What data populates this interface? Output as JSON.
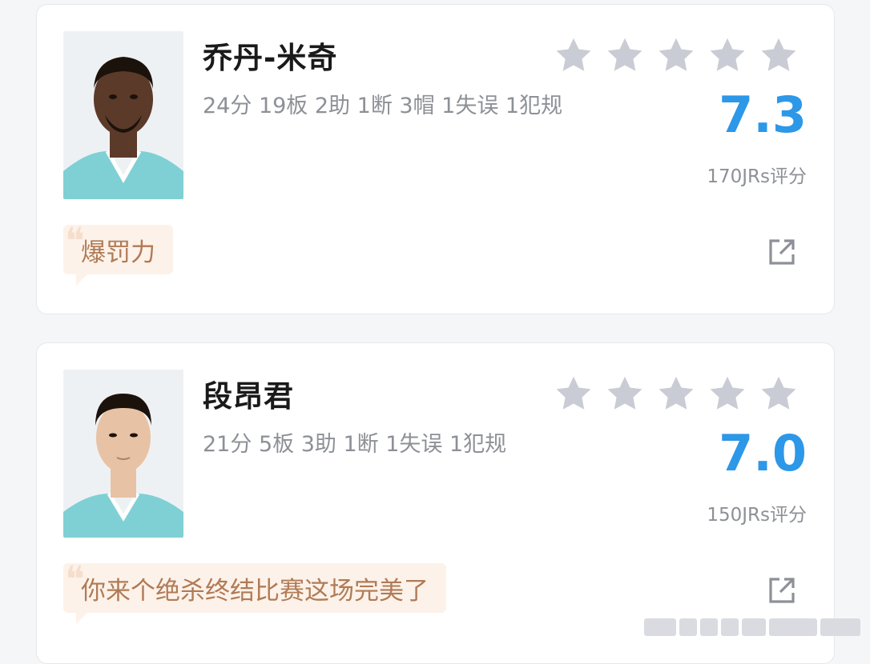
{
  "players": [
    {
      "name": "乔丹-米奇",
      "stats": "24分 19板 2助 1断 3帽 1失误 1犯规",
      "rating_stars": 0,
      "score": "7.3",
      "votes": "170JRs评分",
      "comment": "爆罚力",
      "jersey_color": "#7fd0d4",
      "skin_color": "#5b3a2a"
    },
    {
      "name": "段昂君",
      "stats": "21分 5板 3助 1断 1失误 1犯规",
      "rating_stars": 0,
      "score": "7.0",
      "votes": "150JRs评分",
      "comment": "你来个绝杀终结比赛这场完美了",
      "jersey_color": "#7fd0d4",
      "skin_color": "#e8c2a4"
    }
  ],
  "colors": {
    "accent": "#2d97e8",
    "star_empty": "#c9ccd4",
    "comment_bg": "#fdf2e9",
    "comment_text": "#b07b56"
  },
  "icons": {
    "star": "star-icon",
    "share": "share-external-icon",
    "quote": "quote-icon"
  }
}
